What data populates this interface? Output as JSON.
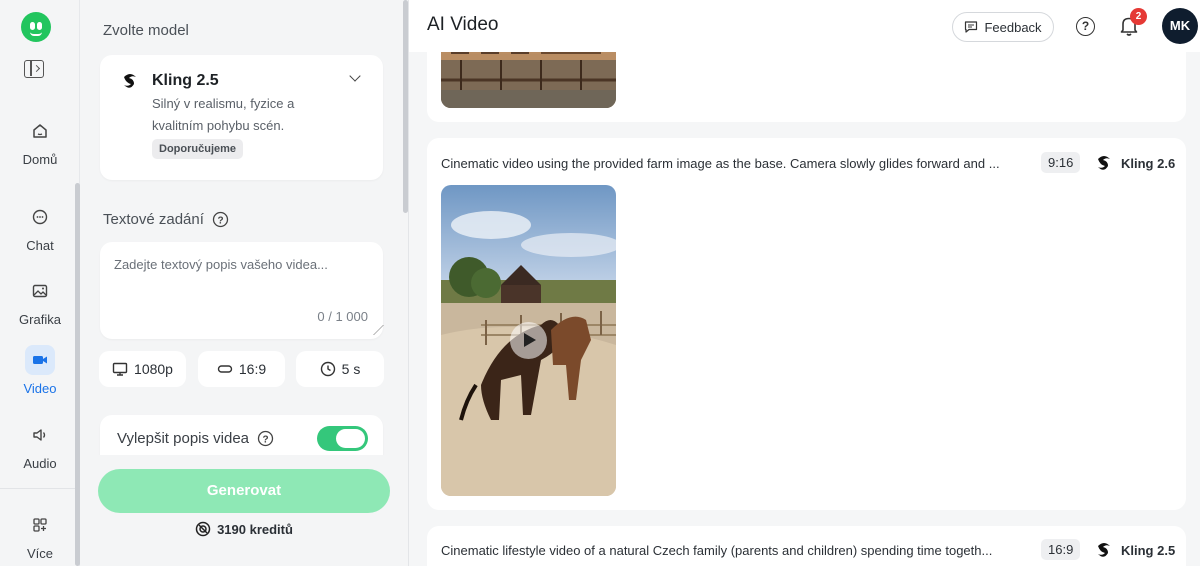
{
  "nav": {
    "items": [
      {
        "label": "Domů",
        "icon": "home-icon"
      },
      {
        "label": "Chat",
        "icon": "chat-icon"
      },
      {
        "label": "Grafika",
        "icon": "image-icon"
      },
      {
        "label": "Video",
        "icon": "video-icon",
        "active": true
      },
      {
        "label": "Audio",
        "icon": "speaker-icon"
      },
      {
        "label": "Více",
        "icon": "more-apps-icon"
      }
    ]
  },
  "panel": {
    "model_section_title": "Zvolte model",
    "model": {
      "name": "Kling 2.5",
      "description": "Silný v realismu, fyzice a kvalitním pohybu scén.",
      "badge": "Doporučujeme"
    },
    "prompt_section_title": "Textové zadání",
    "prompt_placeholder": "Zadejte textový popis vašeho videa...",
    "prompt_counter": "0 / 1 000",
    "resolution": "1080p",
    "aspect_ratio": "16:9",
    "duration": "5 s",
    "improve_label": "Vylepšit popis videa",
    "improve_enabled": true,
    "generate_label": "Generovat",
    "credits": "3190 kreditů"
  },
  "main": {
    "title": "AI Video",
    "feedback_label": "Feedback",
    "notification_count": "2",
    "avatar_initials": "MK",
    "videos": [
      {
        "prompt": "Cinematic video using the provided farm image as the base. Camera slowly glides forward and ...",
        "ratio": "9:16",
        "model": "Kling 2.6"
      },
      {
        "prompt": "Cinematic lifestyle video of a natural Czech family (parents and children) spending time togeth...",
        "ratio": "16:9",
        "model": "Kling 2.5"
      }
    ]
  },
  "colors": {
    "accent": "#1a73e8",
    "brand_green": "#22c55e",
    "generate_disabled": "#8ee8b5",
    "toggle_on": "#34c77b",
    "notification": "#e53935"
  }
}
